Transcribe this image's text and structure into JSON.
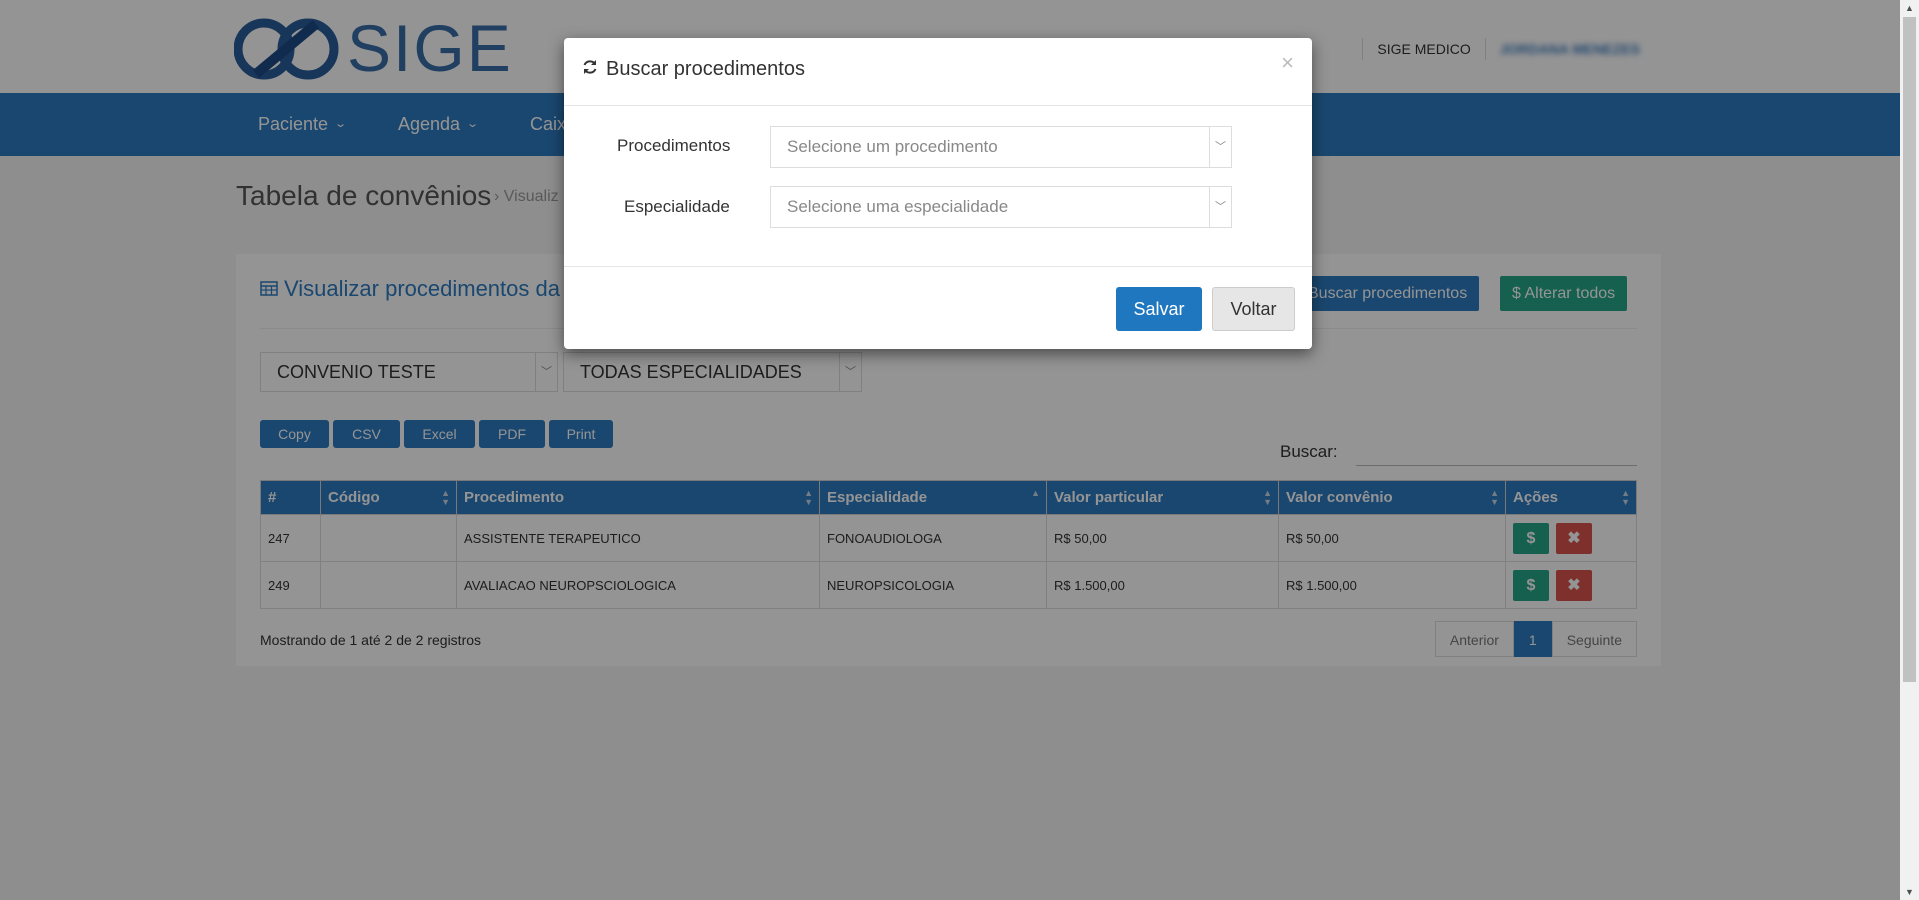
{
  "header": {
    "logo_text": "SIGE",
    "account": "SIGE MEDICO",
    "user": "JORDANA MENEZES"
  },
  "nav": {
    "items": [
      {
        "label": "Paciente"
      },
      {
        "label": "Agenda"
      },
      {
        "label": "Caixa"
      }
    ]
  },
  "breadcrumb": {
    "title": "Tabela de convênios",
    "sub": "› Visualiz"
  },
  "panel": {
    "title": "Visualizar procedimentos da",
    "buscar_label": "Buscar procedimentos",
    "alterar_label": "Alterar todos",
    "convenio_value": "CONVENIO TESTE",
    "especialidade_value": "TODAS ESPECIALIDADES",
    "export_buttons": [
      "Copy",
      "CSV",
      "Excel",
      "PDF",
      "Print"
    ],
    "search_label": "Buscar:",
    "columns": [
      "#",
      "Código",
      "Procedimento",
      "Especialidade",
      "Valor particular",
      "Valor convênio",
      "Ações"
    ],
    "rows": [
      {
        "id": "247",
        "codigo": "",
        "procedimento": "ASSISTENTE TERAPEUTICO",
        "especialidade": "FONOAUDIOLOGA",
        "valor_particular": "R$ 50,00",
        "valor_convenio": "R$ 50,00"
      },
      {
        "id": "249",
        "codigo": "",
        "procedimento": "AVALIACAO NEUROPSCIOLOGICA",
        "especialidade": "NEUROPSICOLOGIA",
        "valor_particular": "R$ 1.500,00",
        "valor_convenio": "R$ 1.500,00"
      }
    ],
    "showing": "Mostrando de 1 até 2 de 2 registros",
    "pager": {
      "prev": "Anterior",
      "current": "1",
      "next": "Seguinte"
    }
  },
  "modal": {
    "title": "Buscar procedimentos",
    "close": "×",
    "procedimentos_label": "Procedimentos",
    "procedimentos_placeholder": "Selecione um procedimento",
    "especialidade_label": "Especialidade",
    "especialidade_placeholder": "Selecione uma especialidade",
    "salvar": "Salvar",
    "voltar": "Voltar"
  },
  "colors": {
    "primary": "#2e7bc1",
    "success": "#26a58b",
    "danger": "#d9534f"
  }
}
